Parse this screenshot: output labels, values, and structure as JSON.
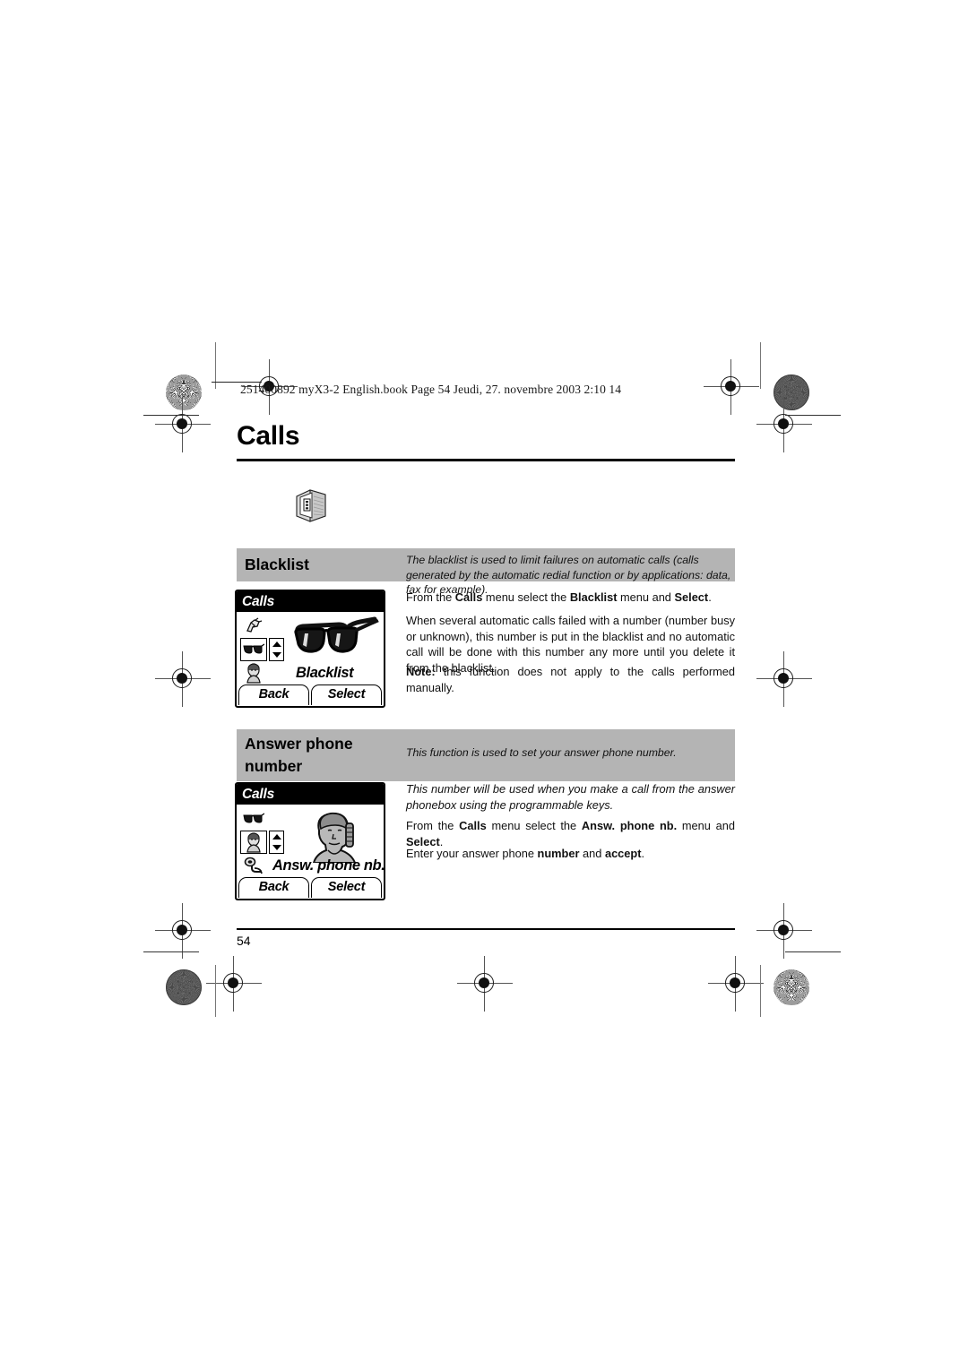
{
  "document": {
    "header_line": "251400892 myX3-2 English.book  Page 54  Jeudi, 27. novembre 2003  2:10 14",
    "chapter_title": "Calls",
    "page_number": "54"
  },
  "sections": [
    {
      "id": "blacklist",
      "title": "Blacklist",
      "description": "The blacklist is used to limit failures on automatic calls (calls generated by the automatic redial function or by applications: data, fax for example).",
      "paragraphs": [
        "From the Calls menu select the Blacklist menu and Select.",
        "When several automatic calls failed with a number (number busy or unknown), this number is put in the blacklist and no automatic call will be done with this number any more until you delete it from the blacklist.",
        "Note: this function does not apply to the calls performed manually."
      ],
      "screen": {
        "titlebar": "Calls",
        "menu_label": "Blacklist",
        "left_softkey": "Back",
        "right_softkey": "Select",
        "icons": [
          "broken-phone-icon",
          "sunglasses-icon",
          "person-head-icon"
        ],
        "selected_icon": "sunglasses-icon",
        "artwork": "sunglasses-illustration"
      }
    },
    {
      "id": "answer-phone-number",
      "title": "Answer phone number",
      "title_line1": "Answer phone",
      "title_line2": "number",
      "description": "This function is used to set your answer phone number.",
      "paragraphs": [
        "This number will be used when you make a call from the answer phonebox using the programmable keys.",
        "From the Calls menu select the Answ. phone nb. menu and Select.",
        "Enter your answer phone number and accept."
      ],
      "screen": {
        "titlebar": "Calls",
        "menu_label": "Answ. phone nb.",
        "left_softkey": "Back",
        "right_softkey": "Select",
        "icons": [
          "sunglasses-icon",
          "person-head-icon",
          "phone-handset-icon"
        ],
        "selected_icon": "person-head-icon",
        "artwork": "person-illustration"
      }
    }
  ],
  "colors": {
    "band_gray": "#b4b4b4",
    "text_black": "#111111",
    "screen_black": "#000000"
  }
}
